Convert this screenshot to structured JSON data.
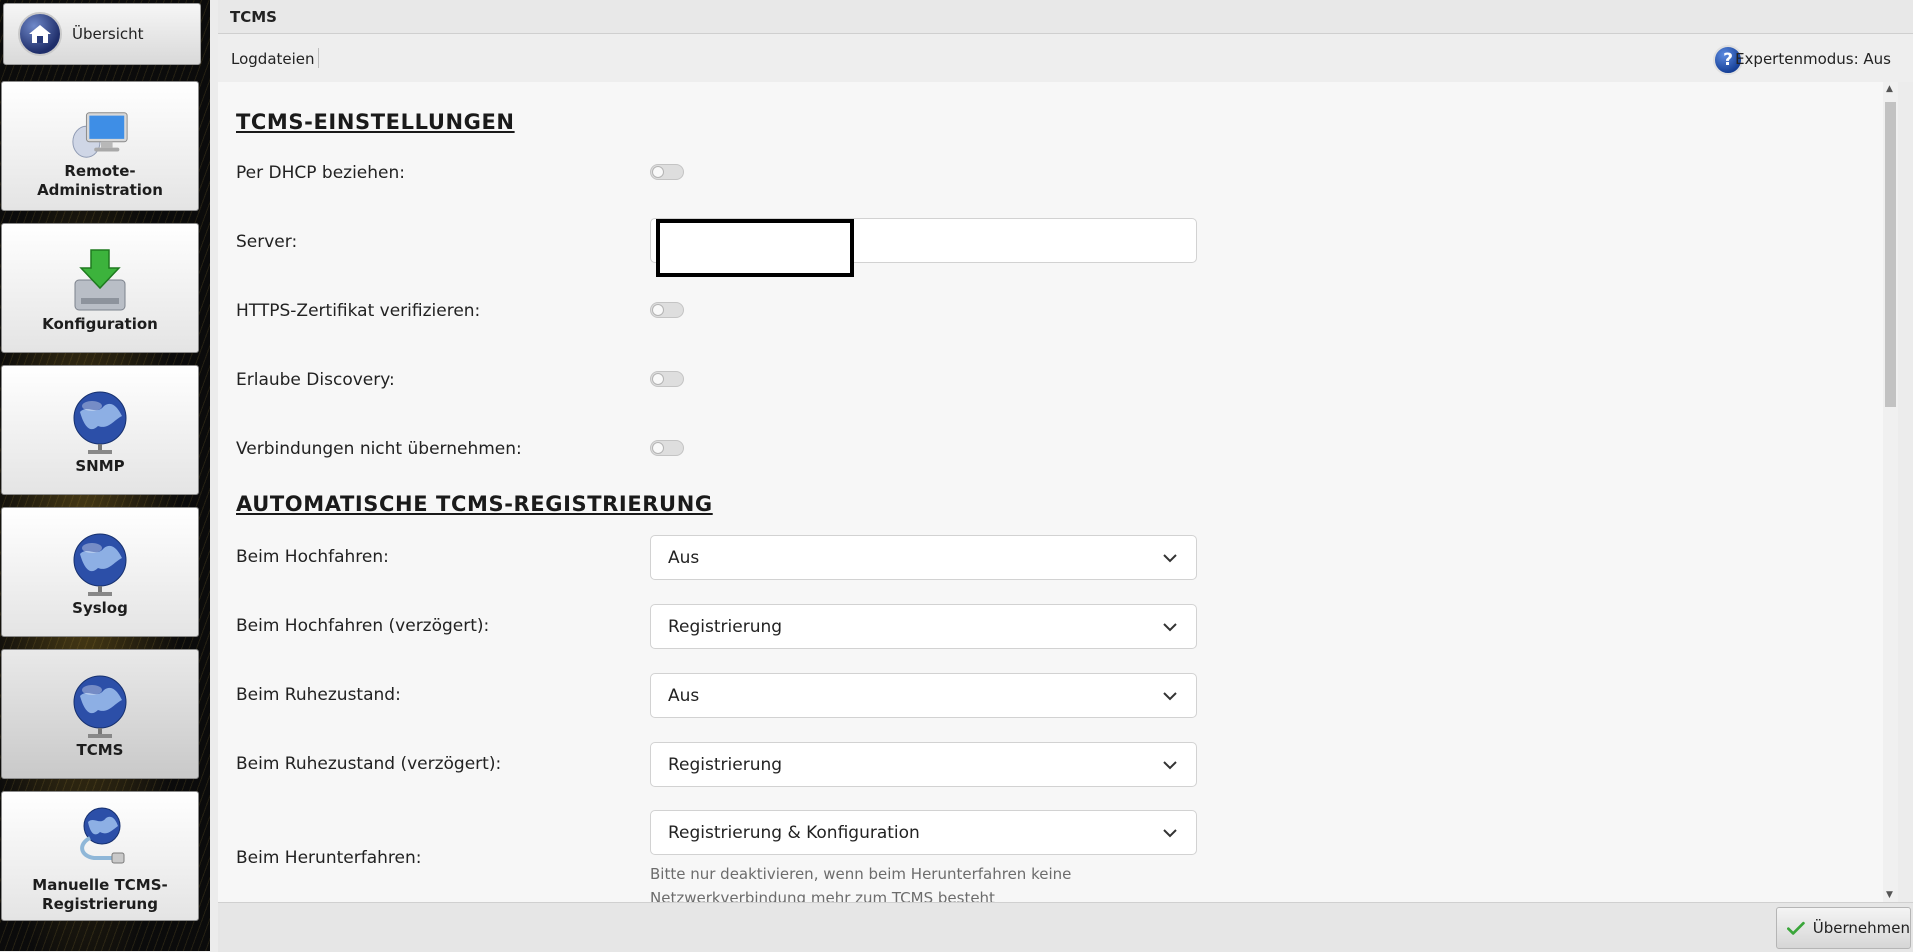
{
  "sidebar": {
    "home": {
      "label": "Übersicht",
      "icon": "home-icon"
    },
    "items": [
      {
        "label": "Remote-Administration",
        "icon": "monitor-network-icon",
        "active": false
      },
      {
        "label": "Konfiguration",
        "icon": "download-drive-icon",
        "active": false
      },
      {
        "label": "SNMP",
        "icon": "globe-network-icon",
        "active": false
      },
      {
        "label": "Syslog",
        "icon": "globe-network-icon",
        "active": false
      },
      {
        "label": "TCMS",
        "icon": "globe-network-icon",
        "active": true
      },
      {
        "label": "Manuelle TCMS-Registrierung",
        "icon": "globe-cable-icon",
        "active": false
      }
    ]
  },
  "header": {
    "title": "TCMS"
  },
  "toolbar": {
    "logs_link": "Logdateien",
    "help_icon": "?",
    "expert_mode": "Expertenmodus: Aus"
  },
  "settings": {
    "section_title": "TCMS-EINSTELLUNGEN",
    "dhcp_label": "Per DHCP beziehen:",
    "dhcp_on": false,
    "server_label": "Server:",
    "server_value": "",
    "https_label": "HTTPS-Zertifikat verifizieren:",
    "https_on": false,
    "discovery_label": "Erlaube Discovery:",
    "discovery_on": false,
    "connections_label": "Verbindungen nicht übernehmen:",
    "connections_on": false
  },
  "registration": {
    "section_title": "AUTOMATISCHE TCMS-REGISTRIERUNG",
    "rows": [
      {
        "label": "Beim Hochfahren:",
        "value": "Aus"
      },
      {
        "label": "Beim Hochfahren (verzögert):",
        "value": "Registrierung"
      },
      {
        "label": "Beim Ruhezustand:",
        "value": "Aus"
      },
      {
        "label": "Beim Ruhezustand (verzögert):",
        "value": "Registrierung"
      },
      {
        "label": "Beim Herunterfahren:",
        "value": "Registrierung & Konfiguration"
      }
    ],
    "shutdown_hint": "Bitte nur deaktivieren, wenn beim Herunterfahren keine Netzwerkverbindung mehr zum TCMS besteht"
  },
  "footer": {
    "apply_label": "Übernehmen",
    "apply_icon": "checkmark-icon"
  },
  "colors": {
    "accent_blue": "#1f3f8f",
    "check_green": "#3aa63a"
  }
}
